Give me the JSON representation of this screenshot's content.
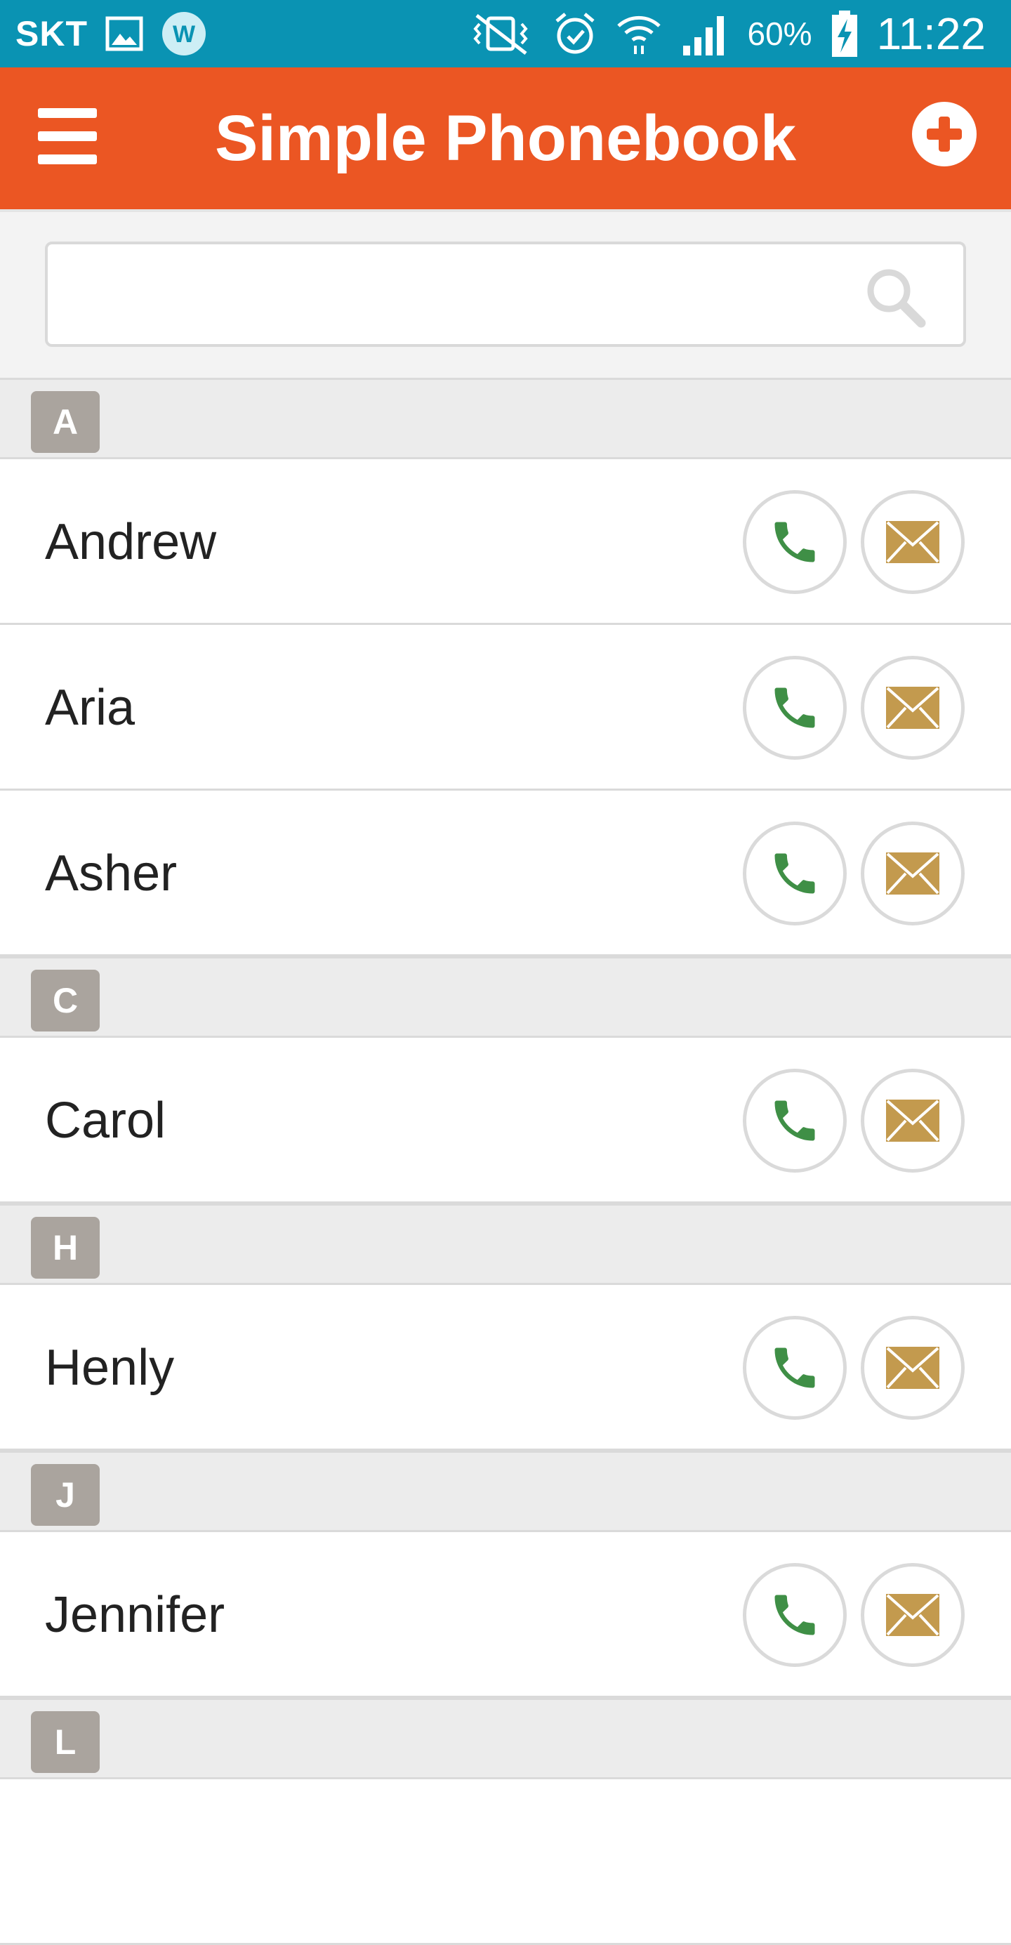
{
  "status_bar": {
    "carrier": "SKT",
    "battery": "60%",
    "time": "11:22",
    "icons": [
      "gallery-icon",
      "w-app-icon",
      "vibrate-icon",
      "alarm-icon",
      "wifi-icon",
      "signal-icon",
      "battery-charging-icon"
    ]
  },
  "app_bar": {
    "title": "Simple Phonebook",
    "menu_icon": "hamburger-menu-icon",
    "add_icon": "plus-circle-icon"
  },
  "search": {
    "value": "",
    "placeholder": "",
    "icon": "search-icon"
  },
  "sections": [
    {
      "letter": "A",
      "contacts": [
        "Andrew",
        "Aria",
        "Asher"
      ]
    },
    {
      "letter": "C",
      "contacts": [
        "Carol"
      ]
    },
    {
      "letter": "H",
      "contacts": [
        "Henly"
      ]
    },
    {
      "letter": "J",
      "contacts": [
        "Jennifer"
      ]
    },
    {
      "letter": "L",
      "contacts": []
    }
  ],
  "colors": {
    "status_bar": "#0a93b3",
    "app_bar": "#eb5623",
    "call_icon": "#3f8f46",
    "mail_icon": "#c39a4e",
    "badge": "#aaa49e"
  }
}
